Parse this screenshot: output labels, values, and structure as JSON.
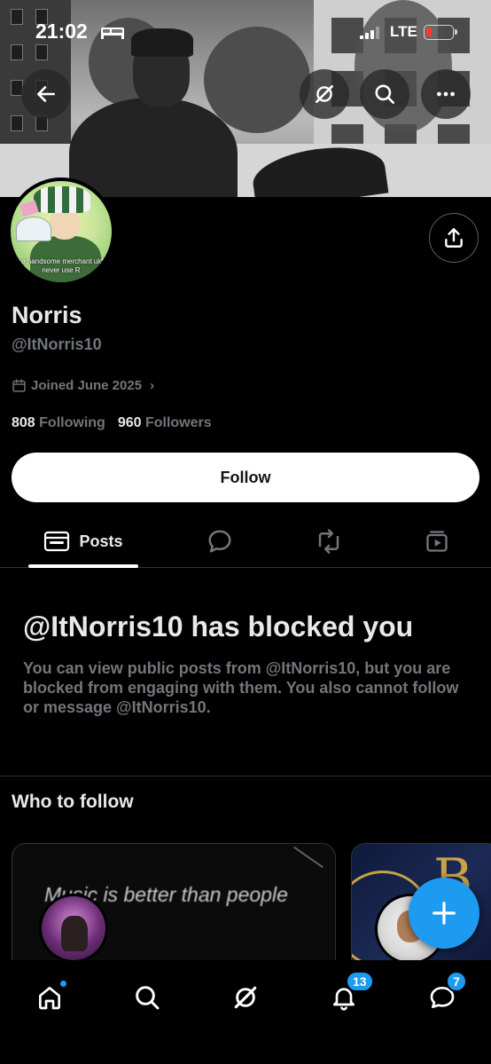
{
  "status_bar": {
    "time": "21:02",
    "network": "LTE",
    "battery_level": 0.12
  },
  "header": {
    "back_icon": "arrow-left-icon",
    "grok_icon": "grok-icon",
    "search_icon": "search-icon",
    "more_icon": "more-horizontal-icon"
  },
  "profile": {
    "avatar_caption": "re handsome merchant uld never use R",
    "display_name": "Norris",
    "handle": "@ItNorris10",
    "joined": "Joined June 2025",
    "joined_chevron": "›",
    "following_count": "808",
    "following_label": "Following",
    "followers_count": "960",
    "followers_label": "Followers",
    "follow_button": "Follow"
  },
  "tabs": [
    {
      "label": "Posts",
      "icon": "posts-icon",
      "active": true
    },
    {
      "label": "",
      "icon": "reply-icon",
      "active": false
    },
    {
      "label": "",
      "icon": "repost-icon",
      "active": false
    },
    {
      "label": "",
      "icon": "media-icon",
      "active": false
    }
  ],
  "blocked": {
    "title": "@ItNorris10 has blocked you",
    "description": "You can view public posts from @ItNorris10, but you are blocked from engaging with them. You also cannot follow or message @ItNorris10."
  },
  "who_to_follow": {
    "title": "Who to follow",
    "cards": [
      {
        "banner_text": "Music is better than people"
      },
      {
        "banner_text": "B"
      }
    ]
  },
  "bottom_nav": {
    "items": [
      "home-icon",
      "search-icon",
      "grok-icon",
      "bell-icon",
      "messages-icon"
    ],
    "notifications_badge": "13",
    "messages_badge": "7"
  },
  "colors": {
    "accent": "#1d9bf0",
    "background": "#000000",
    "text_primary": "#e7e9ea",
    "text_secondary": "#71767b",
    "border": "#2f3336"
  }
}
